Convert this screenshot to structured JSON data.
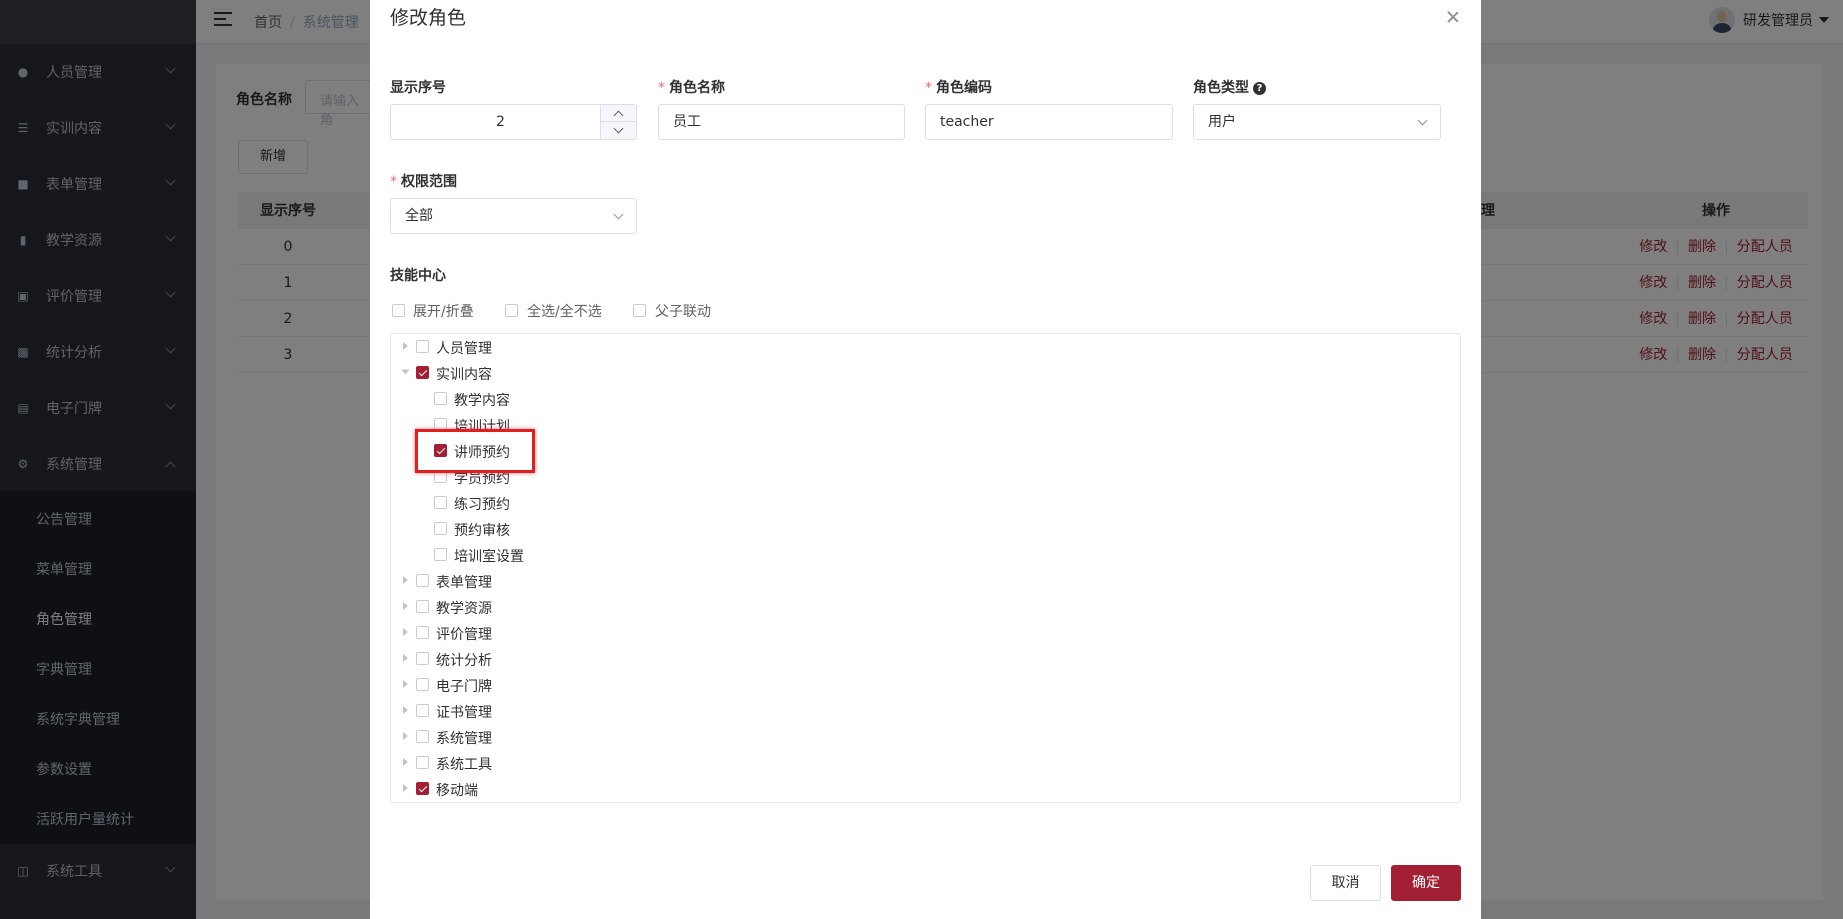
{
  "sidebar": {
    "items": [
      {
        "label": "人员管理",
        "icon": "people-icon"
      },
      {
        "label": "实训内容",
        "icon": "list-icon"
      },
      {
        "label": "表单管理",
        "icon": "form-icon"
      },
      {
        "label": "教学资源",
        "icon": "book-icon"
      },
      {
        "label": "评价管理",
        "icon": "chart-icon"
      },
      {
        "label": "统计分析",
        "icon": "bar-chart-icon"
      },
      {
        "label": "电子门牌",
        "icon": "monitor-icon"
      },
      {
        "label": "系统管理",
        "icon": "gear-icon"
      }
    ],
    "sub_items": [
      "公告管理",
      "菜单管理",
      "角色管理",
      "字典管理",
      "系统字典管理",
      "参数设置",
      "活跃用户量统计"
    ],
    "active_sub": "角色管理",
    "tools": {
      "label": "系统工具",
      "icon": "toolbox-icon"
    }
  },
  "header": {
    "breadcrumb": [
      "首页",
      "系统管理"
    ],
    "user_name": "研发管理员"
  },
  "page": {
    "search_label": "角色名称",
    "search_placeholder": "请输入角",
    "add_button": "新增",
    "table": {
      "headers": [
        "显示序号",
        "理",
        "操作"
      ],
      "rows": [
        "0",
        "1",
        "2",
        "3"
      ],
      "ops": [
        "修改",
        "删除",
        "分配人员"
      ]
    }
  },
  "dialog": {
    "title": "修改角色",
    "fields": {
      "sort": {
        "label": "显示序号",
        "value": "2"
      },
      "name": {
        "label": "角色名称",
        "value": "员工"
      },
      "code": {
        "label": "角色编码",
        "value": "teacher"
      },
      "type": {
        "label": "角色类型",
        "value": "用户"
      },
      "scope": {
        "label": "权限范围",
        "value": "全部"
      }
    },
    "menu_label": "技能中心",
    "tree_options": [
      "展开/折叠",
      "全选/全不选",
      "父子联动"
    ],
    "tree": [
      {
        "label": "人员管理",
        "checked": false,
        "level": 0,
        "expand": "closed"
      },
      {
        "label": "实训内容",
        "checked": true,
        "level": 0,
        "expand": "open"
      },
      {
        "label": "教学内容",
        "checked": false,
        "level": 1,
        "expand": "none"
      },
      {
        "label": "培训计划",
        "checked": false,
        "level": 1,
        "expand": "none"
      },
      {
        "label": "讲师预约",
        "checked": true,
        "level": 1,
        "expand": "none"
      },
      {
        "label": "学员预约",
        "checked": false,
        "level": 1,
        "expand": "none"
      },
      {
        "label": "练习预约",
        "checked": false,
        "level": 1,
        "expand": "none"
      },
      {
        "label": "预约审核",
        "checked": false,
        "level": 1,
        "expand": "none"
      },
      {
        "label": "培训室设置",
        "checked": false,
        "level": 1,
        "expand": "none"
      },
      {
        "label": "表单管理",
        "checked": false,
        "level": 0,
        "expand": "closed"
      },
      {
        "label": "教学资源",
        "checked": false,
        "level": 0,
        "expand": "closed"
      },
      {
        "label": "评价管理",
        "checked": false,
        "level": 0,
        "expand": "closed"
      },
      {
        "label": "统计分析",
        "checked": false,
        "level": 0,
        "expand": "closed"
      },
      {
        "label": "电子门牌",
        "checked": false,
        "level": 0,
        "expand": "closed"
      },
      {
        "label": "证书管理",
        "checked": false,
        "level": 0,
        "expand": "closed"
      },
      {
        "label": "系统管理",
        "checked": false,
        "level": 0,
        "expand": "closed"
      },
      {
        "label": "系统工具",
        "checked": false,
        "level": 0,
        "expand": "closed"
      },
      {
        "label": "移动端",
        "checked": true,
        "level": 0,
        "expand": "closed"
      }
    ],
    "cancel": "取消",
    "confirm": "确定"
  },
  "colors": {
    "accent": "#a31f34",
    "sidebar_bg": "#2b2f3a",
    "highlight": "#e02020"
  }
}
